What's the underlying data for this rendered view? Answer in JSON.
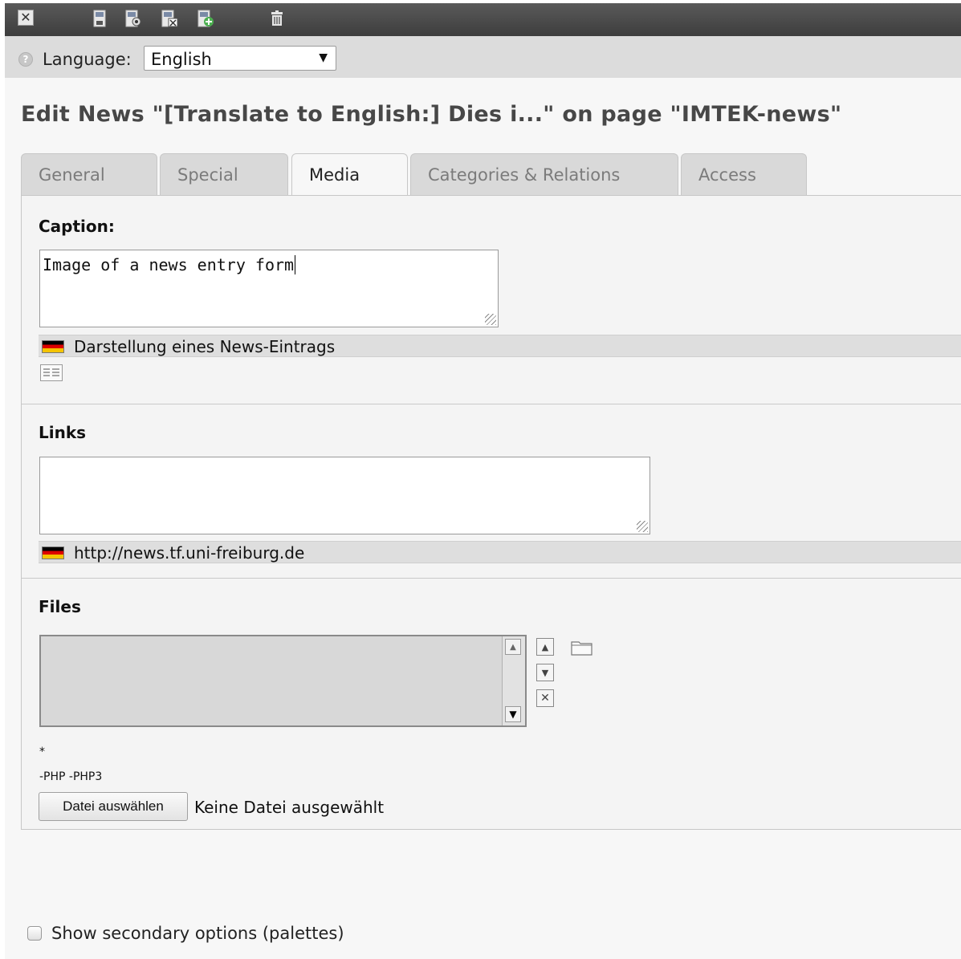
{
  "toolbar": {
    "close_glyph": "✕",
    "icons": [
      "close-icon",
      "save-icon",
      "save-and-view-icon",
      "save-and-close-icon",
      "save-and-new-icon",
      "delete-icon"
    ]
  },
  "language": {
    "label": "Language:",
    "selected": "English"
  },
  "page_title": "Edit News \"[Translate to English:] Dies i...\" on page \"IMTEK-news\"",
  "tabs": [
    {
      "label": "General",
      "active": false
    },
    {
      "label": "Special",
      "active": false
    },
    {
      "label": "Media",
      "active": true
    },
    {
      "label": "Categories & Relations",
      "active": false
    },
    {
      "label": "Access",
      "active": false
    }
  ],
  "caption": {
    "label": "Caption:",
    "value": "Image of a news entry form",
    "original_text": "Darstellung eines News-Eintrags"
  },
  "links": {
    "label": "Links",
    "value": "",
    "original_text": "http://news.tf.uni-freiburg.de"
  },
  "files": {
    "label": "Files",
    "allowed": "*",
    "disallowed": "-PHP -PHP3",
    "choose_button": "Datei auswählen",
    "no_file": "Keine Datei ausgewählt"
  },
  "secondary_options": {
    "label": "Show secondary options (palettes)",
    "checked": false
  }
}
